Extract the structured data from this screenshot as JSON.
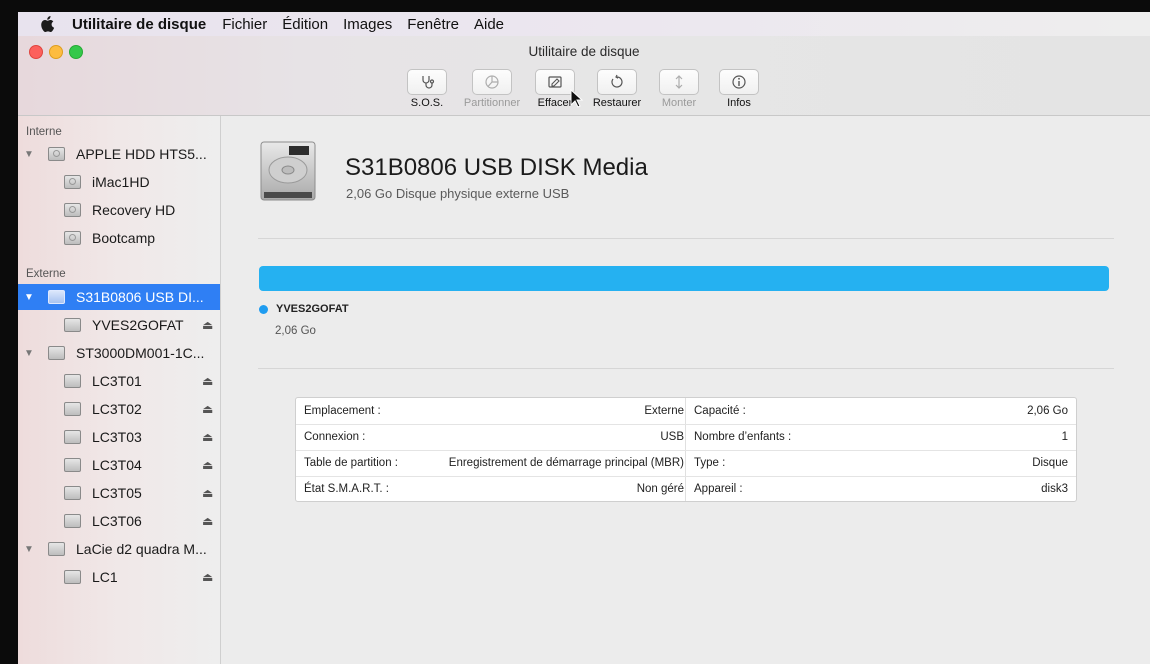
{
  "menubar": {
    "app_name": "Utilitaire de disque",
    "items": [
      "Fichier",
      "Édition",
      "Images",
      "Fenêtre",
      "Aide"
    ]
  },
  "window": {
    "title": "Utilitaire de disque"
  },
  "toolbar": {
    "buttons": [
      {
        "label": "S.O.S.",
        "icon": "stethoscope-icon",
        "enabled": true
      },
      {
        "label": "Partitionner",
        "icon": "partition-pie-icon",
        "enabled": false
      },
      {
        "label": "Effacer",
        "icon": "erase-icon",
        "enabled": true
      },
      {
        "label": "Restaurer",
        "icon": "restore-icon",
        "enabled": true
      },
      {
        "label": "Monter",
        "icon": "mount-icon",
        "enabled": false
      },
      {
        "label": "Infos",
        "icon": "info-icon",
        "enabled": true
      }
    ]
  },
  "sidebar": {
    "sections": [
      {
        "title": "Interne",
        "items": [
          {
            "label": "APPLE HDD HTS5...",
            "level": 0,
            "expanded": true,
            "icon": "internal-disk-icon"
          },
          {
            "label": "iMac1HD",
            "level": 1,
            "icon": "internal-volume-icon"
          },
          {
            "label": "Recovery HD",
            "level": 1,
            "icon": "internal-volume-icon"
          },
          {
            "label": "Bootcamp",
            "level": 1,
            "icon": "internal-volume-icon"
          }
        ]
      },
      {
        "title": "Externe",
        "items": [
          {
            "label": "S31B0806 USB DI...",
            "level": 0,
            "expanded": true,
            "selected": true,
            "icon": "external-disk-icon"
          },
          {
            "label": "YVES2GOFAT",
            "level": 1,
            "eject": true,
            "icon": "external-volume-icon"
          },
          {
            "label": "ST3000DM001-1C...",
            "level": 0,
            "expanded": true,
            "icon": "external-disk-icon"
          },
          {
            "label": "LC3T01",
            "level": 1,
            "eject": true,
            "icon": "external-volume-icon"
          },
          {
            "label": "LC3T02",
            "level": 1,
            "eject": true,
            "icon": "external-volume-icon"
          },
          {
            "label": "LC3T03",
            "level": 1,
            "eject": true,
            "icon": "external-volume-icon"
          },
          {
            "label": "LC3T04",
            "level": 1,
            "eject": true,
            "icon": "external-volume-icon"
          },
          {
            "label": "LC3T05",
            "level": 1,
            "eject": true,
            "icon": "external-volume-icon"
          },
          {
            "label": "LC3T06",
            "level": 1,
            "eject": true,
            "icon": "external-volume-icon"
          },
          {
            "label": "LaCie d2 quadra M...",
            "level": 0,
            "expanded": true,
            "icon": "external-disk-icon"
          },
          {
            "label": "LC1",
            "level": 1,
            "eject": true,
            "icon": "external-volume-icon"
          }
        ]
      }
    ]
  },
  "disk": {
    "name": "S31B0806 USB DISK Media",
    "subtitle": "2,06 Go Disque physique externe USB",
    "volume": {
      "name": "YVES2GOFAT",
      "size": "2,06 Go",
      "color": "#1f9cf0",
      "fraction": 1.0
    }
  },
  "info": {
    "rows": [
      {
        "k1": "Emplacement :",
        "v1": "Externe",
        "k2": "Capacité :",
        "v2": "2,06 Go"
      },
      {
        "k1": "Connexion :",
        "v1": "USB",
        "k2": "Nombre d’enfants :",
        "v2": "1"
      },
      {
        "k1": "Table de partition :",
        "v1": "Enregistrement de démarrage principal (MBR)",
        "k2": "Type :",
        "v2": "Disque"
      },
      {
        "k1": "État S.M.A.R.T. :",
        "v1": "Non géré",
        "k2": "Appareil :",
        "v2": "disk3"
      }
    ]
  },
  "colors": {
    "accent": "#2f7ff4",
    "usage_bar": "#25b1f1"
  }
}
